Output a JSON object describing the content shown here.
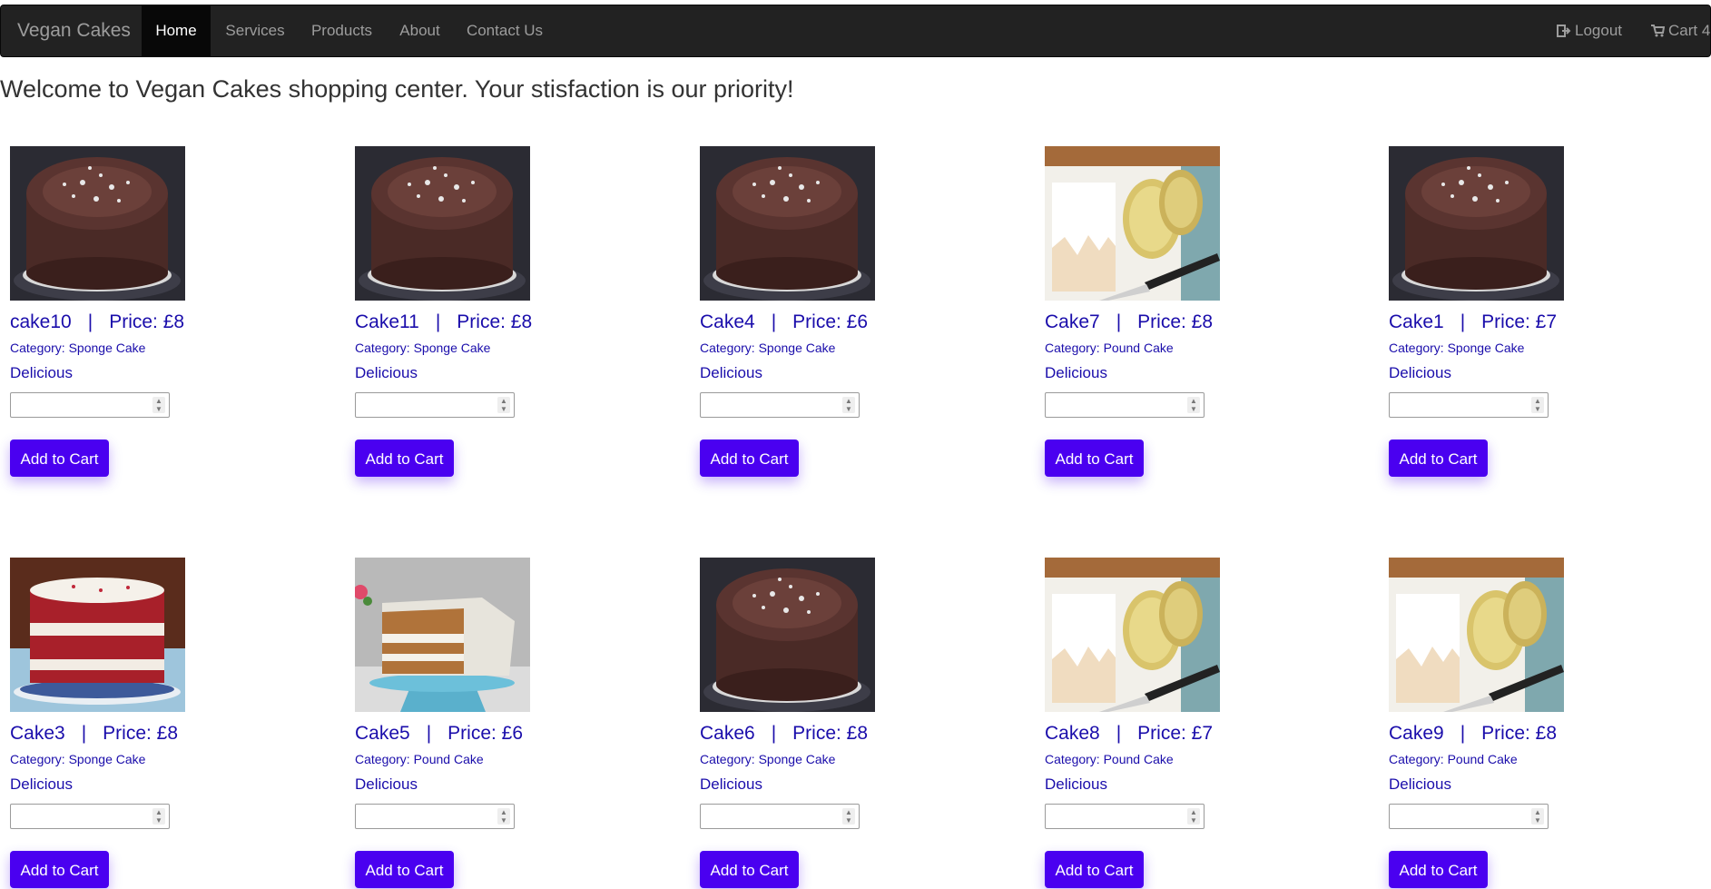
{
  "nav": {
    "brand": "Vegan Cakes",
    "items": [
      "Home",
      "Services",
      "Products",
      "About",
      "Contact Us"
    ],
    "logout": "Logout",
    "cart": "Cart 4"
  },
  "welcome": "Welcome to Vegan Cakes shopping center. Your stisfaction is our priority!",
  "products": [
    {
      "name": "cake10",
      "price": "Price: £8",
      "category": "Category: Sponge Cake",
      "desc": "Delicious",
      "button": "Add to Cart",
      "image": "chocolate-cake"
    },
    {
      "name": "Cake11",
      "price": "Price: £8",
      "category": "Category: Sponge Cake",
      "desc": "Delicious",
      "button": "Add to Cart",
      "image": "chocolate-cake"
    },
    {
      "name": "Cake4",
      "price": "Price: £6",
      "category": "Category: Sponge Cake",
      "desc": "Delicious",
      "button": "Add to Cart",
      "image": "chocolate-cake"
    },
    {
      "name": "Cake7",
      "price": "Price: £8",
      "category": "Category: Pound Cake",
      "desc": "Delicious",
      "button": "Add to Cart",
      "image": "lemon-loaf"
    },
    {
      "name": "Cake1",
      "price": "Price: £7",
      "category": "Category: Sponge Cake",
      "desc": "Delicious",
      "button": "Add to Cart",
      "image": "chocolate-cake"
    },
    {
      "name": "Cake3",
      "price": "Price: £8",
      "category": "Category: Sponge Cake",
      "desc": "Delicious",
      "button": "Add to Cart",
      "image": "red-velvet-cake"
    },
    {
      "name": "Cake5",
      "price": "Price: £6",
      "category": "Category: Pound Cake",
      "desc": "Delicious",
      "button": "Add to Cart",
      "image": "carrot-cake"
    },
    {
      "name": "Cake6",
      "price": "Price: £8",
      "category": "Category: Sponge Cake",
      "desc": "Delicious",
      "button": "Add to Cart",
      "image": "chocolate-cake"
    },
    {
      "name": "Cake8",
      "price": "Price: £7",
      "category": "Category: Pound Cake",
      "desc": "Delicious",
      "button": "Add to Cart",
      "image": "lemon-loaf"
    },
    {
      "name": "Cake9",
      "price": "Price: £8",
      "category": "Category: Pound Cake",
      "desc": "Delicious",
      "button": "Add to Cart",
      "image": "lemon-loaf"
    }
  ],
  "colors": {
    "navbar_bg": "#222222",
    "nav_active_bg": "#080808",
    "link_text": "#1a0dab",
    "button_bg": "#4a00f0"
  }
}
